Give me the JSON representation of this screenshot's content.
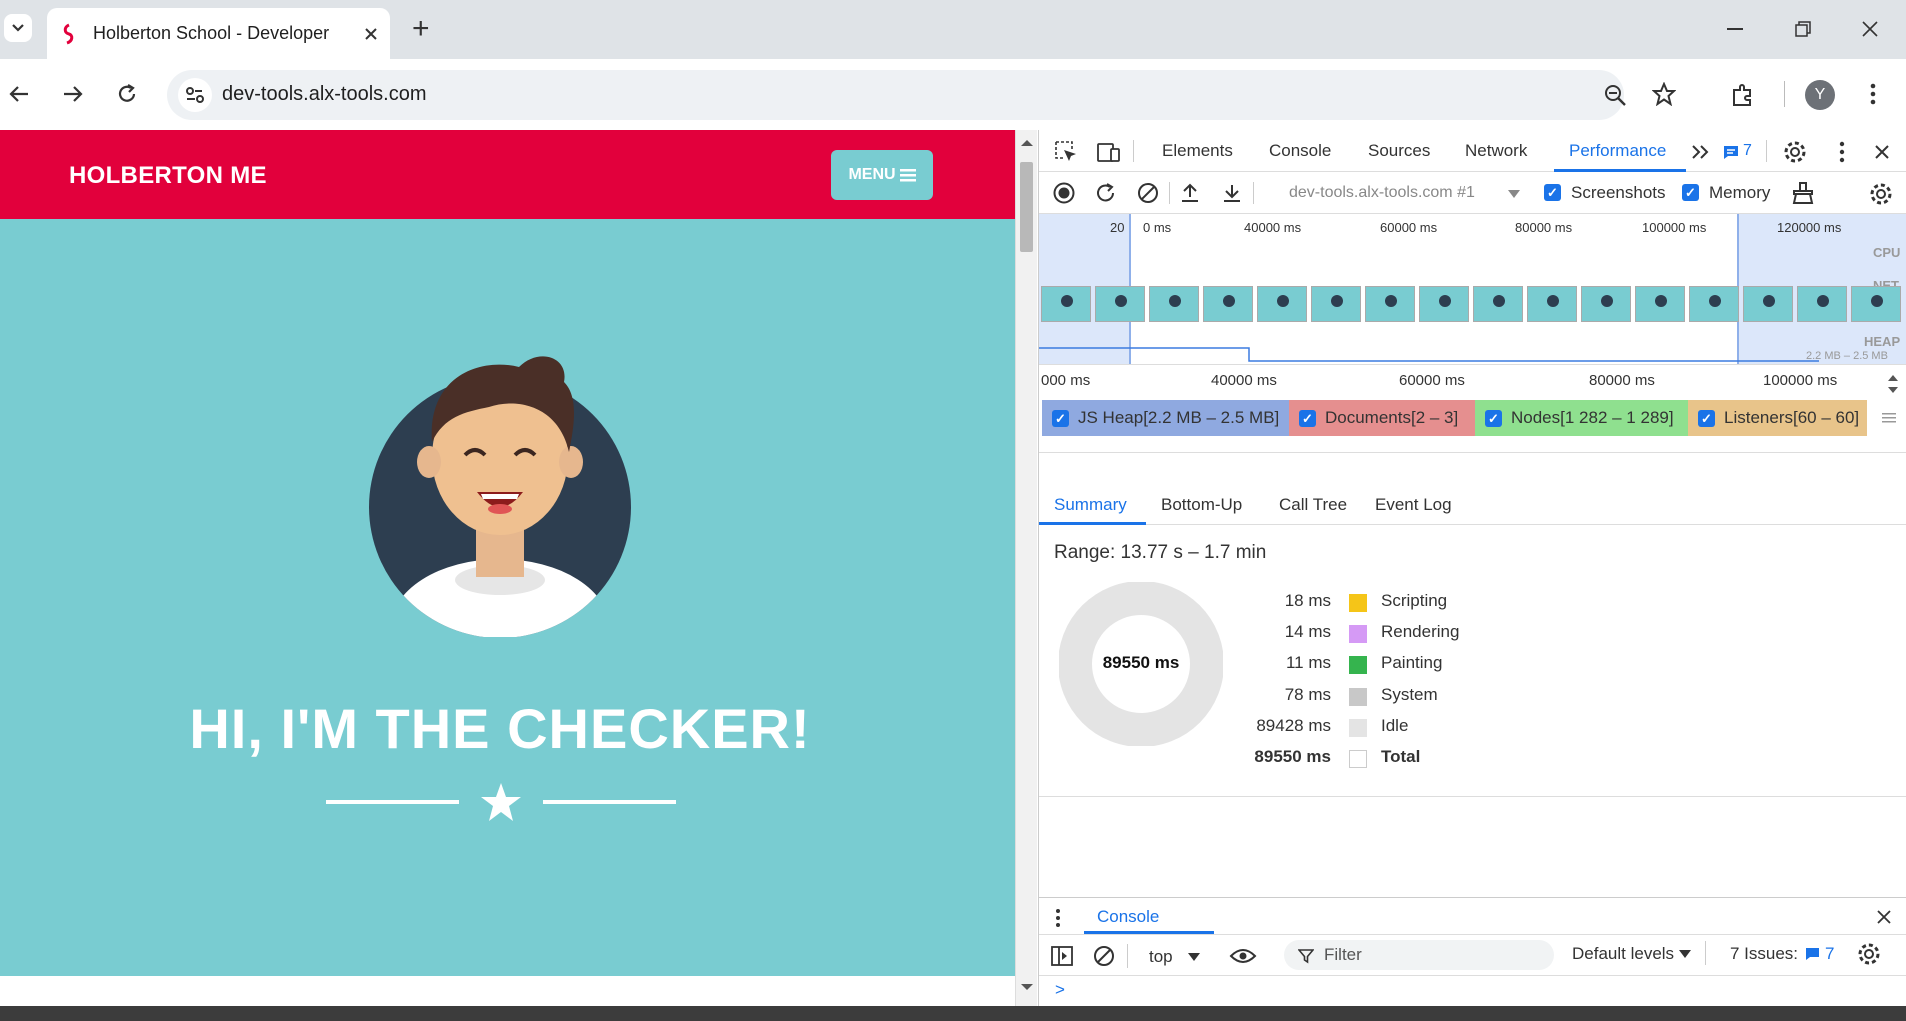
{
  "browser": {
    "tab_title": "Holberton School - Developer t",
    "new_tab": "+",
    "url": "dev-tools.alx-tools.com",
    "profile_initial": "Y"
  },
  "page": {
    "brand": "HOLBERTON ME",
    "menu_label": "MENU",
    "hero_title": "HI, I'M THE CHECKER!",
    "colors": {
      "nav": "#e2003c",
      "hero": "#79ccd1"
    }
  },
  "devtools": {
    "tabs": [
      "Elements",
      "Console",
      "Sources",
      "Network",
      "Performance"
    ],
    "issues_count": "7",
    "recording_target": "dev-tools.alx-tools.com #1",
    "screenshots_label": "Screenshots",
    "memory_label": "Memory",
    "overview": {
      "top_ticks": [
        "20",
        "0 ms",
        "40000 ms",
        "60000 ms",
        "80000 ms",
        "100000 ms",
        "120000 ms"
      ],
      "track_labels": [
        "CPU",
        "NET",
        "HEAP"
      ],
      "heap_range": "2.2 MB – 2.5 MB",
      "bottom_ticks": [
        "000 ms",
        "40000 ms",
        "60000 ms",
        "80000 ms",
        "100000 ms"
      ]
    },
    "memory_legend": [
      {
        "label": "JS Heap[2.2 MB – 2.5 MB]",
        "color": "#8fa9e0"
      },
      {
        "label": "Documents[2 – 3]",
        "color": "#e58f8f"
      },
      {
        "label": "Nodes[1 282 – 1 289]",
        "color": "#8fe08f"
      },
      {
        "label": "Listeners[60 – 60]",
        "color": "#e8c48a"
      }
    ],
    "sub_tabs": [
      "Summary",
      "Bottom-Up",
      "Call Tree",
      "Event Log"
    ],
    "range": "Range: 13.77 s – 1.7 min",
    "donut_total": "89550 ms",
    "summary": [
      {
        "value": "18 ms",
        "label": "Scripting",
        "color": "#f5c518"
      },
      {
        "value": "14 ms",
        "label": "Rendering",
        "color": "#d59af5"
      },
      {
        "value": "11 ms",
        "label": "Painting",
        "color": "#35b44e"
      },
      {
        "value": "78 ms",
        "label": "System",
        "color": "#c8c8c8"
      },
      {
        "value": "89428 ms",
        "label": "Idle",
        "color": "#e4e4e4"
      },
      {
        "value": "89550 ms",
        "label": "Total",
        "color": "#ffffff"
      }
    ],
    "console": {
      "title": "Console",
      "context": "top",
      "filter_placeholder": "Filter",
      "levels": "Default levels",
      "issues_label": "7 Issues:",
      "issues_count": "7",
      "prompt": ">"
    }
  }
}
